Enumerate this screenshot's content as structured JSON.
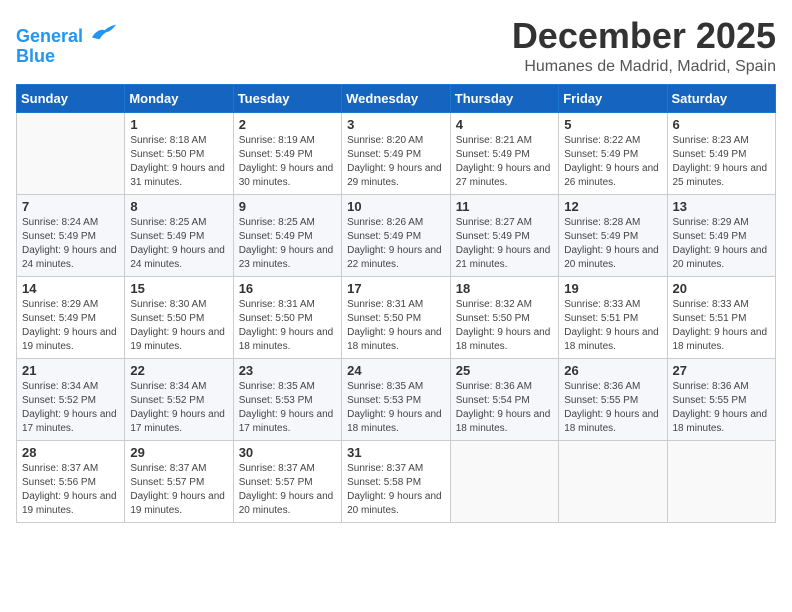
{
  "header": {
    "logo_line1": "General",
    "logo_line2": "Blue",
    "month_year": "December 2025",
    "location": "Humanes de Madrid, Madrid, Spain"
  },
  "days_of_week": [
    "Sunday",
    "Monday",
    "Tuesday",
    "Wednesday",
    "Thursday",
    "Friday",
    "Saturday"
  ],
  "weeks": [
    [
      {
        "day": "",
        "sunrise": "",
        "sunset": "",
        "daylight": ""
      },
      {
        "day": "1",
        "sunrise": "Sunrise: 8:18 AM",
        "sunset": "Sunset: 5:50 PM",
        "daylight": "Daylight: 9 hours and 31 minutes."
      },
      {
        "day": "2",
        "sunrise": "Sunrise: 8:19 AM",
        "sunset": "Sunset: 5:49 PM",
        "daylight": "Daylight: 9 hours and 30 minutes."
      },
      {
        "day": "3",
        "sunrise": "Sunrise: 8:20 AM",
        "sunset": "Sunset: 5:49 PM",
        "daylight": "Daylight: 9 hours and 29 minutes."
      },
      {
        "day": "4",
        "sunrise": "Sunrise: 8:21 AM",
        "sunset": "Sunset: 5:49 PM",
        "daylight": "Daylight: 9 hours and 27 minutes."
      },
      {
        "day": "5",
        "sunrise": "Sunrise: 8:22 AM",
        "sunset": "Sunset: 5:49 PM",
        "daylight": "Daylight: 9 hours and 26 minutes."
      },
      {
        "day": "6",
        "sunrise": "Sunrise: 8:23 AM",
        "sunset": "Sunset: 5:49 PM",
        "daylight": "Daylight: 9 hours and 25 minutes."
      }
    ],
    [
      {
        "day": "7",
        "sunrise": "Sunrise: 8:24 AM",
        "sunset": "Sunset: 5:49 PM",
        "daylight": "Daylight: 9 hours and 24 minutes."
      },
      {
        "day": "8",
        "sunrise": "Sunrise: 8:25 AM",
        "sunset": "Sunset: 5:49 PM",
        "daylight": "Daylight: 9 hours and 24 minutes."
      },
      {
        "day": "9",
        "sunrise": "Sunrise: 8:25 AM",
        "sunset": "Sunset: 5:49 PM",
        "daylight": "Daylight: 9 hours and 23 minutes."
      },
      {
        "day": "10",
        "sunrise": "Sunrise: 8:26 AM",
        "sunset": "Sunset: 5:49 PM",
        "daylight": "Daylight: 9 hours and 22 minutes."
      },
      {
        "day": "11",
        "sunrise": "Sunrise: 8:27 AM",
        "sunset": "Sunset: 5:49 PM",
        "daylight": "Daylight: 9 hours and 21 minutes."
      },
      {
        "day": "12",
        "sunrise": "Sunrise: 8:28 AM",
        "sunset": "Sunset: 5:49 PM",
        "daylight": "Daylight: 9 hours and 20 minutes."
      },
      {
        "day": "13",
        "sunrise": "Sunrise: 8:29 AM",
        "sunset": "Sunset: 5:49 PM",
        "daylight": "Daylight: 9 hours and 20 minutes."
      }
    ],
    [
      {
        "day": "14",
        "sunrise": "Sunrise: 8:29 AM",
        "sunset": "Sunset: 5:49 PM",
        "daylight": "Daylight: 9 hours and 19 minutes."
      },
      {
        "day": "15",
        "sunrise": "Sunrise: 8:30 AM",
        "sunset": "Sunset: 5:50 PM",
        "daylight": "Daylight: 9 hours and 19 minutes."
      },
      {
        "day": "16",
        "sunrise": "Sunrise: 8:31 AM",
        "sunset": "Sunset: 5:50 PM",
        "daylight": "Daylight: 9 hours and 18 minutes."
      },
      {
        "day": "17",
        "sunrise": "Sunrise: 8:31 AM",
        "sunset": "Sunset: 5:50 PM",
        "daylight": "Daylight: 9 hours and 18 minutes."
      },
      {
        "day": "18",
        "sunrise": "Sunrise: 8:32 AM",
        "sunset": "Sunset: 5:50 PM",
        "daylight": "Daylight: 9 hours and 18 minutes."
      },
      {
        "day": "19",
        "sunrise": "Sunrise: 8:33 AM",
        "sunset": "Sunset: 5:51 PM",
        "daylight": "Daylight: 9 hours and 18 minutes."
      },
      {
        "day": "20",
        "sunrise": "Sunrise: 8:33 AM",
        "sunset": "Sunset: 5:51 PM",
        "daylight": "Daylight: 9 hours and 18 minutes."
      }
    ],
    [
      {
        "day": "21",
        "sunrise": "Sunrise: 8:34 AM",
        "sunset": "Sunset: 5:52 PM",
        "daylight": "Daylight: 9 hours and 17 minutes."
      },
      {
        "day": "22",
        "sunrise": "Sunrise: 8:34 AM",
        "sunset": "Sunset: 5:52 PM",
        "daylight": "Daylight: 9 hours and 17 minutes."
      },
      {
        "day": "23",
        "sunrise": "Sunrise: 8:35 AM",
        "sunset": "Sunset: 5:53 PM",
        "daylight": "Daylight: 9 hours and 17 minutes."
      },
      {
        "day": "24",
        "sunrise": "Sunrise: 8:35 AM",
        "sunset": "Sunset: 5:53 PM",
        "daylight": "Daylight: 9 hours and 18 minutes."
      },
      {
        "day": "25",
        "sunrise": "Sunrise: 8:36 AM",
        "sunset": "Sunset: 5:54 PM",
        "daylight": "Daylight: 9 hours and 18 minutes."
      },
      {
        "day": "26",
        "sunrise": "Sunrise: 8:36 AM",
        "sunset": "Sunset: 5:55 PM",
        "daylight": "Daylight: 9 hours and 18 minutes."
      },
      {
        "day": "27",
        "sunrise": "Sunrise: 8:36 AM",
        "sunset": "Sunset: 5:55 PM",
        "daylight": "Daylight: 9 hours and 18 minutes."
      }
    ],
    [
      {
        "day": "28",
        "sunrise": "Sunrise: 8:37 AM",
        "sunset": "Sunset: 5:56 PM",
        "daylight": "Daylight: 9 hours and 19 minutes."
      },
      {
        "day": "29",
        "sunrise": "Sunrise: 8:37 AM",
        "sunset": "Sunset: 5:57 PM",
        "daylight": "Daylight: 9 hours and 19 minutes."
      },
      {
        "day": "30",
        "sunrise": "Sunrise: 8:37 AM",
        "sunset": "Sunset: 5:57 PM",
        "daylight": "Daylight: 9 hours and 20 minutes."
      },
      {
        "day": "31",
        "sunrise": "Sunrise: 8:37 AM",
        "sunset": "Sunset: 5:58 PM",
        "daylight": "Daylight: 9 hours and 20 minutes."
      },
      {
        "day": "",
        "sunrise": "",
        "sunset": "",
        "daylight": ""
      },
      {
        "day": "",
        "sunrise": "",
        "sunset": "",
        "daylight": ""
      },
      {
        "day": "",
        "sunrise": "",
        "sunset": "",
        "daylight": ""
      }
    ]
  ]
}
